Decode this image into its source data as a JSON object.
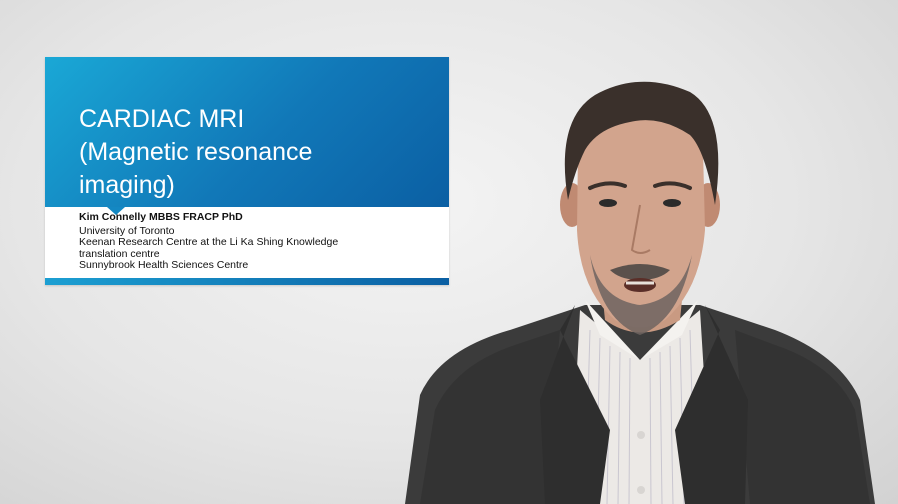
{
  "slide": {
    "title_lines": [
      "CARDIAC MRI",
      "(Magnetic resonance",
      "imaging)"
    ],
    "presenter_name": "Kim Connelly MBBS FRACP PhD",
    "affiliation_lines": [
      "University of Toronto",
      "Keenan Research Centre at the Li Ka Shing Knowledge",
      "translation centre",
      "Sunnybrook Health Sciences Centre"
    ]
  },
  "colors": {
    "banner_light": "#1aa8d6",
    "banner_dark": "#0b5fa3",
    "background": "#e6e6e6",
    "suit": "#3a3a3a",
    "shirt": "#ece9e6"
  }
}
